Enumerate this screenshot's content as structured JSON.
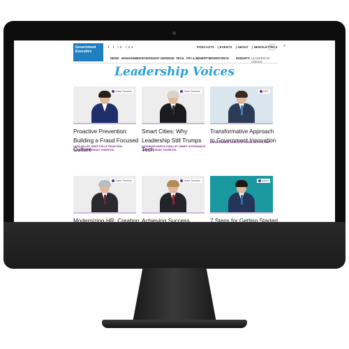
{
  "site": {
    "logo_line1": "Government",
    "logo_line2": "Executive",
    "social": "f  t  in  rss",
    "top_links": [
      "PODCASTS",
      "EVENTS",
      "ABOUT",
      "NEWSLETTERS"
    ],
    "nav": [
      "NEWS",
      "MANAGEMENT",
      "OVERSIGHT",
      "DEFENSE",
      "TECH",
      "PAY & BENEFITS",
      "WORKFORCE",
      "INSIGHTS",
      "LEADERSHIP VOICES"
    ]
  },
  "page": {
    "title": "Leadership Voices"
  },
  "cards": [
    {
      "title": "Proactive Prevention: Building a Fraud Focused Culture",
      "author": "Linda Miller, Director of Fraud Risk Management, Grant Thornton",
      "brand": "Grant Thornton",
      "hair": "#2a1e18",
      "suit": "#1f2f6b",
      "tie": ""
    },
    {
      "title": "Smart Cities: Why Leadership Still Trumps Tech",
      "author": "Governor Martin O'Malley, Smart Governance Advisor, Grant Thornton",
      "brand": "Grant Thornton",
      "hair": "#d9d3c8",
      "suit": "#1b1b1f",
      "tie": "#2c2c2c"
    },
    {
      "title": "Transformative Approach to Government Innovation",
      "author": "Bryan Thomas, Senior VP Public Sector, NWT",
      "brand": "NWT",
      "hair": "#3a2a1f",
      "suit": "#2b3a55",
      "tie": "#3e7ec0"
    },
    {
      "title": "Modernizing HR: Creating",
      "author": "",
      "brand": "Grant Thornton",
      "hair": "#bcbcbc",
      "suit": "#2a2a2e",
      "tie": "#6b2440"
    },
    {
      "title": "Achieving Success",
      "author": "",
      "brand": "Grant Thornton",
      "hair": "#b48a55",
      "suit": "#23232a",
      "tie": "#9b1c2a"
    },
    {
      "title": "7 Steps for Getting Started",
      "author": "",
      "brand": "Valiant",
      "hair": "#1e1712",
      "suit": "#25355a",
      "tie": "#3f6aa8"
    }
  ]
}
